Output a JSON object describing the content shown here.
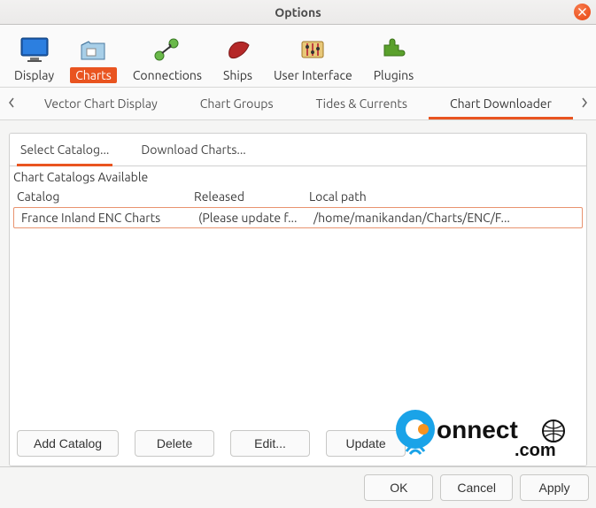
{
  "window": {
    "title": "Options"
  },
  "toolbar": {
    "items": [
      {
        "label": "Display"
      },
      {
        "label": "Charts"
      },
      {
        "label": "Connections"
      },
      {
        "label": "Ships"
      },
      {
        "label": "User Interface"
      },
      {
        "label": "Plugins"
      }
    ],
    "active_index": 1
  },
  "tabs": {
    "items": [
      "Vector Chart Display",
      "Chart Groups",
      "Tides & Currents",
      "Chart Downloader"
    ],
    "active_index": 3
  },
  "inner_tabs": {
    "items": [
      "Select Catalog...",
      "Download Charts..."
    ],
    "active_index": 0
  },
  "section": {
    "heading": "Chart Catalogs Available"
  },
  "table": {
    "columns": {
      "catalog": "Catalog",
      "released": "Released",
      "local_path": "Local path"
    },
    "rows": [
      {
        "catalog": "France Inland ENC Charts",
        "released": "(Please update f...",
        "local_path": "/home/manikandan/Charts/ENC/F..."
      }
    ]
  },
  "actions": {
    "add_catalog": "Add Catalog",
    "delete": "Delete",
    "edit": "Edit...",
    "update": "Update"
  },
  "footer": {
    "ok": "OK",
    "cancel": "Cancel",
    "apply": "Apply"
  },
  "accent": "#e95420",
  "watermark": {
    "text1": "onnect",
    "text2": ".com"
  }
}
